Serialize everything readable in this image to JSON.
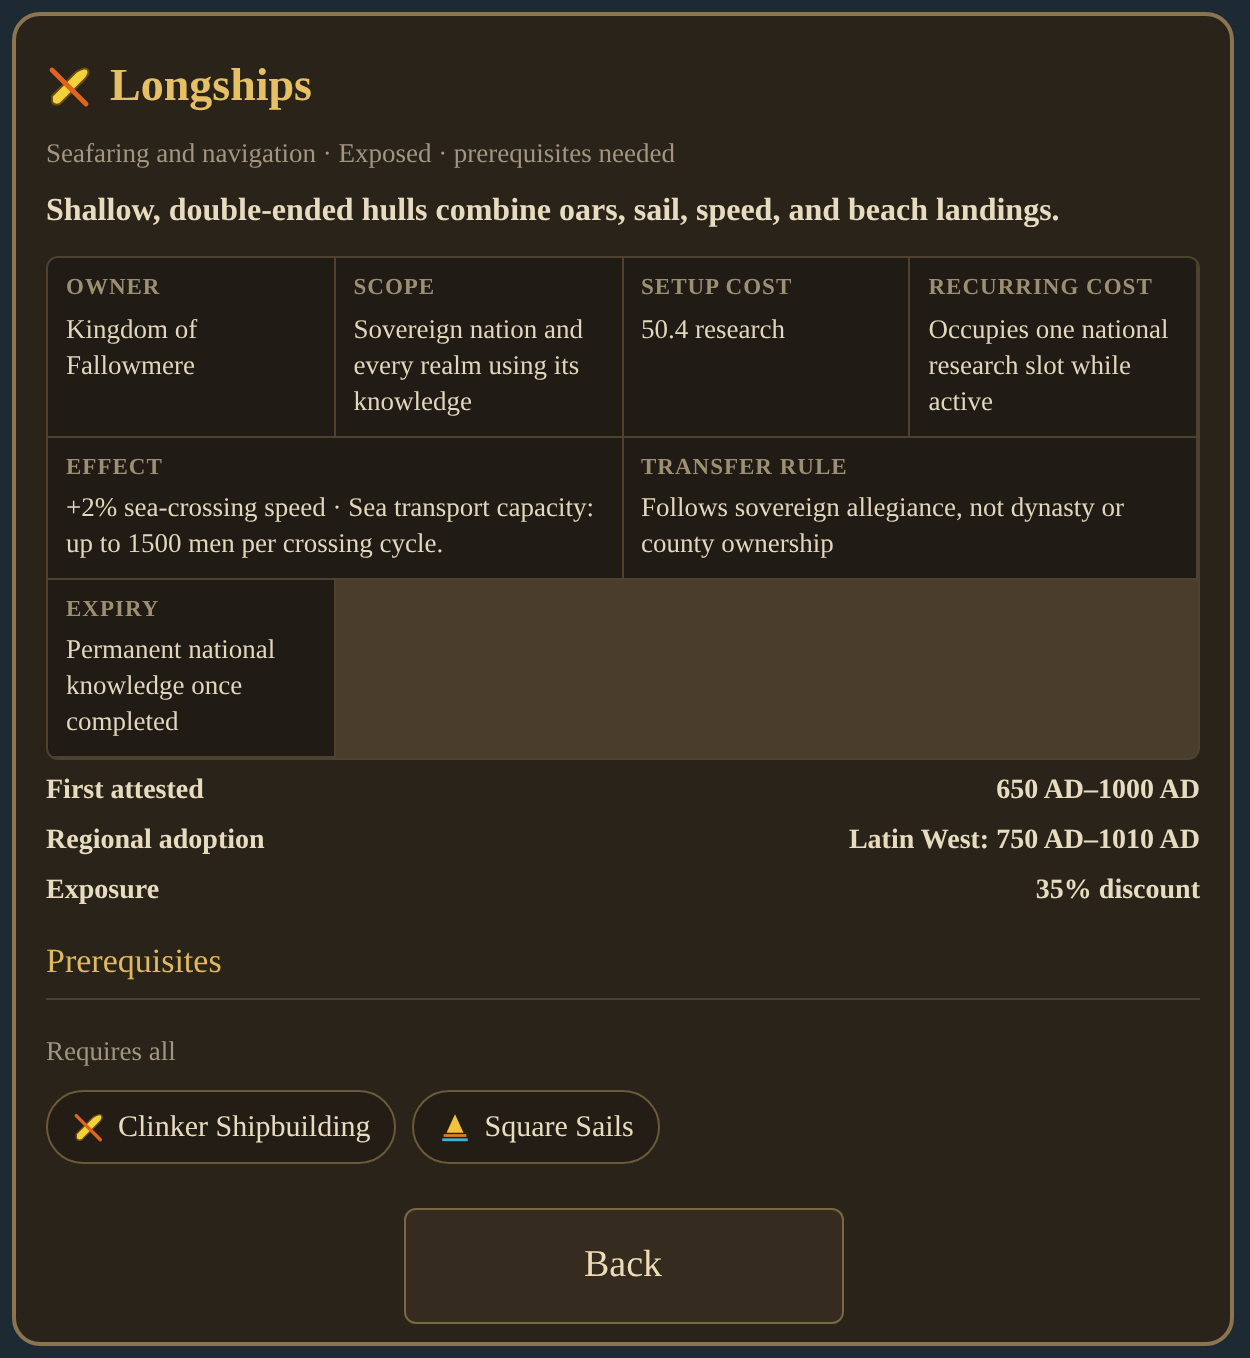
{
  "title": "Longships",
  "subtitle": "Seafaring and navigation · Exposed · prerequisites needed",
  "description": "Shallow, double-ended hulls combine oars, sail, speed, and beach landings.",
  "details": [
    {
      "label": "OWNER",
      "value": "Kingdom of Fallowmere"
    },
    {
      "label": "SCOPE",
      "value": "Sovereign nation and every realm using its knowledge"
    },
    {
      "label": "SETUP COST",
      "value": "50.4 research"
    },
    {
      "label": "RECURRING COST",
      "value": "Occupies one national research slot while active"
    },
    {
      "label": "EFFECT",
      "value": "+2% sea-crossing speed · Sea transport capacity: up to 1500 men per crossing cycle."
    },
    {
      "label": "TRANSFER RULE",
      "value": "Follows sovereign allegiance, not dynasty or county ownership"
    },
    {
      "label": "EXPIRY",
      "value": "Permanent national knowledge once completed"
    }
  ],
  "facts": [
    {
      "label": "First attested",
      "value": "650 AD–1000 AD"
    },
    {
      "label": "Regional adoption",
      "value": "Latin West: 750 AD–1010 AD"
    },
    {
      "label": "Exposure",
      "value": "35% discount"
    }
  ],
  "prerequisites": {
    "heading": "Prerequisites",
    "mode": "Requires all",
    "items": [
      {
        "label": "Clinker Shipbuilding"
      },
      {
        "label": "Square Sails"
      }
    ]
  },
  "back_button": "Back"
}
